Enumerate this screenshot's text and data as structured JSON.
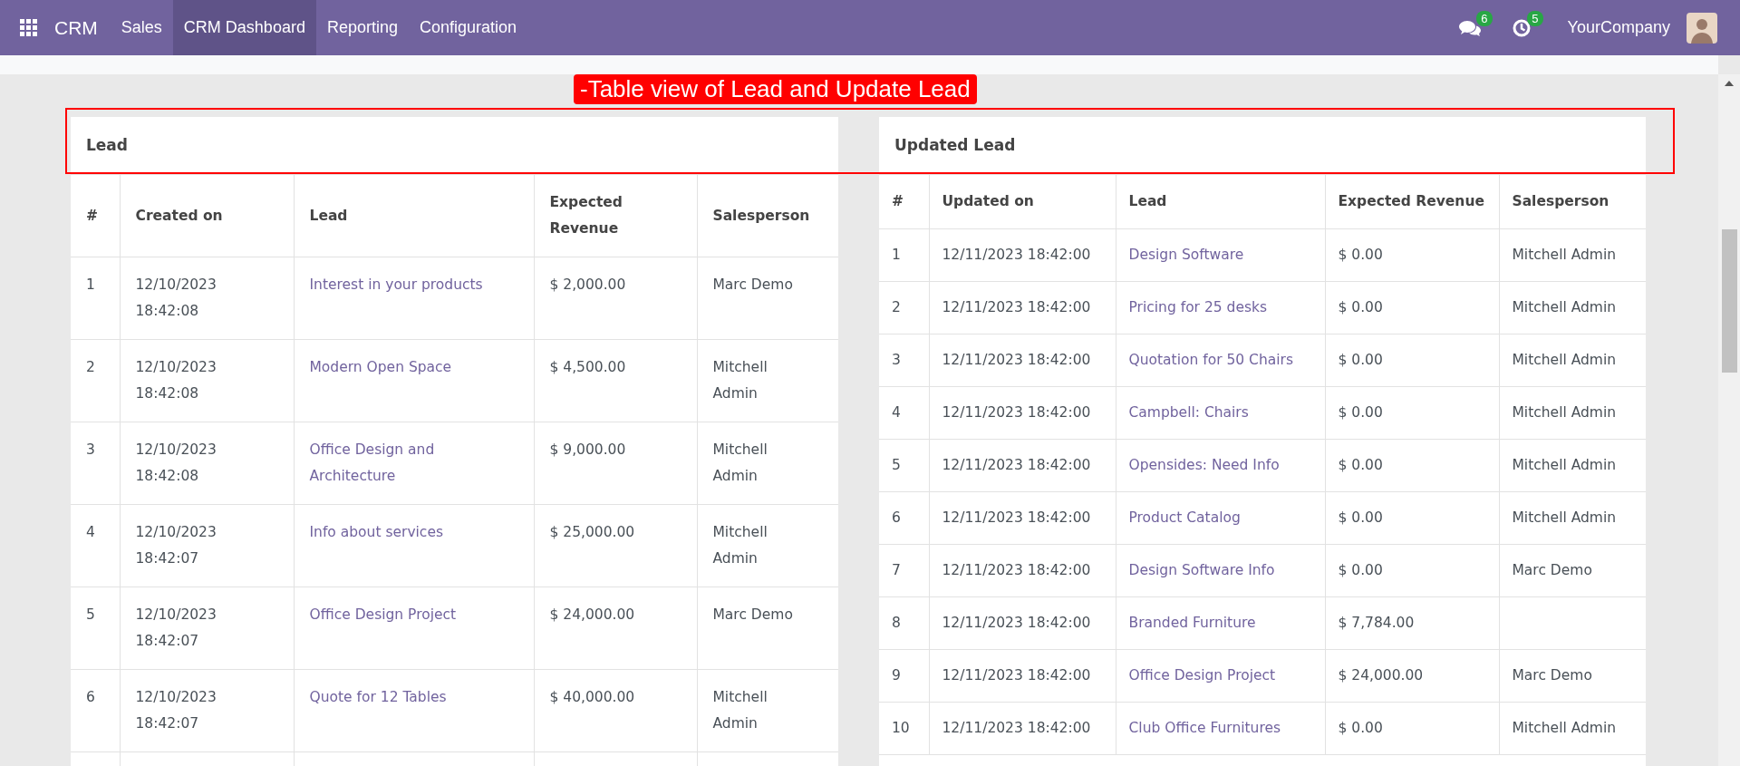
{
  "navbar": {
    "app_name": "CRM",
    "menu": [
      {
        "label": "Sales",
        "selected": false
      },
      {
        "label": "CRM Dashboard",
        "selected": true
      },
      {
        "label": "Reporting",
        "selected": false
      },
      {
        "label": "Configuration",
        "selected": false
      }
    ],
    "messages_badge": "6",
    "activities_badge": "5",
    "company": "YourCompany"
  },
  "annotation": {
    "text": "-Table view of Lead and Update Lead"
  },
  "panels": [
    {
      "title": "Lead",
      "columns": [
        "#",
        "Created on",
        "Lead",
        "Expected Revenue",
        "Salesperson"
      ],
      "rows": [
        [
          "1",
          "12/10/2023 18:42:08",
          "Interest in your products",
          "$ 2,000.00",
          "Marc Demo"
        ],
        [
          "2",
          "12/10/2023 18:42:08",
          "Modern Open Space",
          "$ 4,500.00",
          "Mitchell Admin"
        ],
        [
          "3",
          "12/10/2023 18:42:08",
          "Office Design and Architecture",
          "$ 9,000.00",
          "Mitchell Admin"
        ],
        [
          "4",
          "12/10/2023 18:42:07",
          "Info about services",
          "$ 25,000.00",
          "Mitchell Admin"
        ],
        [
          "5",
          "12/10/2023 18:42:07",
          "Office Design Project",
          "$ 24,000.00",
          "Marc Demo"
        ],
        [
          "6",
          "12/10/2023 18:42:07",
          "Quote for 12 Tables",
          "$ 40,000.00",
          "Mitchell Admin"
        ]
      ]
    },
    {
      "title": "Updated Lead",
      "columns": [
        "#",
        "Updated on",
        "Lead",
        "Expected Revenue",
        "Salesperson"
      ],
      "rows": [
        [
          "1",
          "12/11/2023 18:42:00",
          "Design Software",
          "$ 0.00",
          "Mitchell Admin"
        ],
        [
          "2",
          "12/11/2023 18:42:00",
          "Pricing for 25 desks",
          "$ 0.00",
          "Mitchell Admin"
        ],
        [
          "3",
          "12/11/2023 18:42:00",
          "Quotation for 50 Chairs",
          "$ 0.00",
          "Mitchell Admin"
        ],
        [
          "4",
          "12/11/2023 18:42:00",
          "Campbell: Chairs",
          "$ 0.00",
          "Mitchell Admin"
        ],
        [
          "5",
          "12/11/2023 18:42:00",
          "Opensides: Need Info",
          "$ 0.00",
          "Mitchell Admin"
        ],
        [
          "6",
          "12/11/2023 18:42:00",
          "Product Catalog",
          "$ 0.00",
          "Mitchell Admin"
        ],
        [
          "7",
          "12/11/2023 18:42:00",
          "Design Software Info",
          "$ 0.00",
          "Marc Demo"
        ],
        [
          "8",
          "12/11/2023 18:42:00",
          "Branded Furniture",
          "$ 7,784.00",
          null
        ],
        [
          "9",
          "12/11/2023 18:42:00",
          "Office Design Project",
          "$ 24,000.00",
          "Marc Demo"
        ],
        [
          "10",
          "12/11/2023 18:42:00",
          "Club Office Furnitures",
          "$ 0.00",
          "Mitchell Admin"
        ]
      ]
    }
  ]
}
